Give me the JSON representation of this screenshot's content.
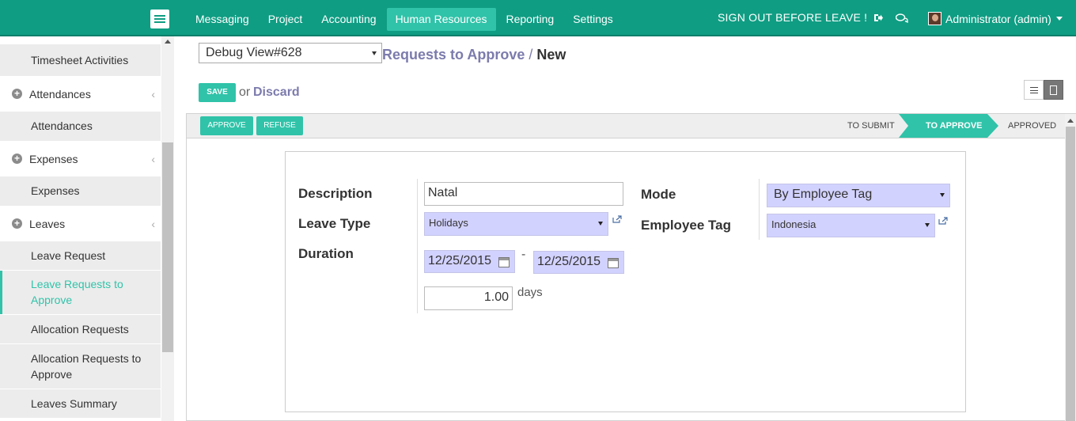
{
  "topbar": {
    "menu": [
      "Messaging",
      "Project",
      "Accounting",
      "Human Resources",
      "Reporting",
      "Settings"
    ],
    "active_menu": "Human Resources",
    "signout": "SIGN OUT BEFORE LEAVE !",
    "user": "Administrator (admin)",
    "bar_color": "#0f9d83",
    "accent": "#30c3a9"
  },
  "sidebar": {
    "timesheet_activities": "Timesheet Activities",
    "attendances_section": "Attendances",
    "attendances": "Attendances",
    "expenses_section": "Expenses",
    "expenses": "Expenses",
    "leaves_section": "Leaves",
    "leave_request": "Leave Request",
    "leave_requests_to_approve": "Leave Requests to Approve",
    "allocation_requests": "Allocation Requests",
    "allocation_requests_to_approve": "Allocation Requests to Approve",
    "leaves_summary": "Leaves Summary"
  },
  "header": {
    "debug_view": "Debug View#628",
    "breadcrumb_parent": "Requests to Approve",
    "breadcrumb_sep": "/",
    "breadcrumb_current": "New",
    "save": "SAVE",
    "or": "or",
    "discard": "Discard"
  },
  "statusbar": {
    "approve": "APPROVE",
    "refuse": "REFUSE",
    "stages": [
      "TO SUBMIT",
      "TO APPROVE",
      "APPROVED"
    ],
    "active_stage": "TO APPROVE"
  },
  "form": {
    "description_label": "Description",
    "description_value": "Natal",
    "leave_type_label": "Leave Type",
    "leave_type_value": "Holidays",
    "duration_label": "Duration",
    "date_from": "12/25/2015",
    "date_sep": "-",
    "date_to": "12/25/2015",
    "days_value": "1.00",
    "days_label": "days",
    "mode_label": "Mode",
    "mode_value": "By Employee Tag",
    "employee_tag_label": "Employee Tag",
    "employee_tag_value": "Indonesia"
  }
}
